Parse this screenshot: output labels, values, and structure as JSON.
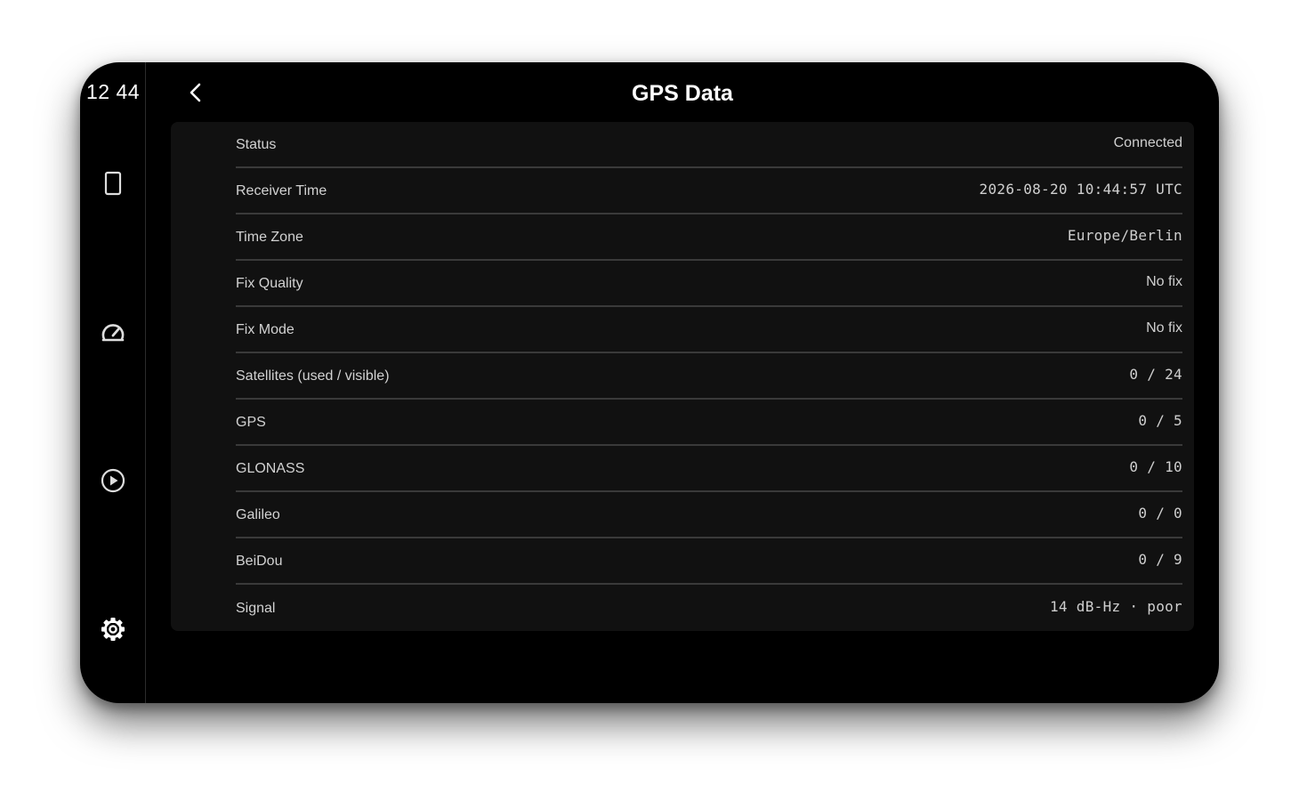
{
  "status_bar": {
    "time": "12 44"
  },
  "nav_rail": {
    "items": [
      {
        "name": "tablet-icon",
        "color": "#dddddd"
      },
      {
        "name": "speedometer-icon",
        "color": "#dddddd"
      },
      {
        "name": "play-circle-icon",
        "color": "#dddddd"
      },
      {
        "name": "gear-icon",
        "color": "#ffffff"
      }
    ]
  },
  "header": {
    "back_icon": "chevron-left-icon",
    "title": "GPS Data"
  },
  "gps_rows": [
    {
      "label": "Status",
      "value": "Connected",
      "mono": false
    },
    {
      "label": "Receiver Time",
      "value": "2026-08-20 10:44:57 UTC",
      "mono": true
    },
    {
      "label": "Time Zone",
      "value": "Europe/Berlin",
      "mono": true
    },
    {
      "label": "Fix Quality",
      "value": "No fix",
      "mono": false
    },
    {
      "label": "Fix Mode",
      "value": "No fix",
      "mono": false
    },
    {
      "label": "Satellites (used / visible)",
      "value": "0 / 24",
      "mono": true
    },
    {
      "label": "GPS",
      "value": "0 / 5",
      "mono": true
    },
    {
      "label": "GLONASS",
      "value": "0 / 10",
      "mono": true
    },
    {
      "label": "Galileo",
      "value": "0 / 0",
      "mono": true
    },
    {
      "label": "BeiDou",
      "value": "0 / 9",
      "mono": true
    },
    {
      "label": "Signal",
      "value": "14 dB-Hz · poor",
      "mono": true
    }
  ],
  "colors": {
    "background": "#000000",
    "card": "#111111",
    "divider": "#3a3a3a",
    "text": "#d2d2d2",
    "title": "#ffffff"
  }
}
